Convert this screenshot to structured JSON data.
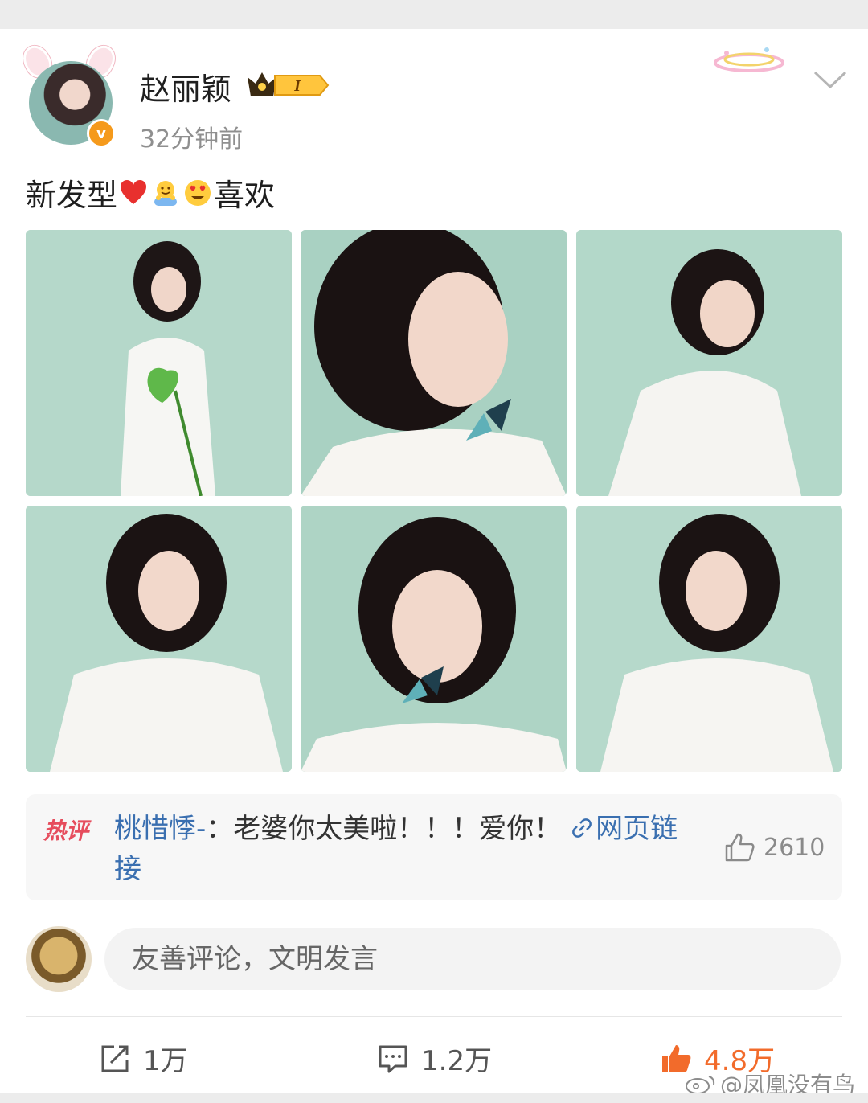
{
  "post": {
    "username": "赵丽颖",
    "vip_level": "I",
    "timestamp": "32分钟前",
    "text_before": "新发型",
    "text_after": "喜欢",
    "emojis": [
      "heart-emoji",
      "hug-emoji",
      "heart-eyes-emoji"
    ],
    "photo_count": 6
  },
  "hot_comment": {
    "badge": "热评",
    "author": "桃惜悸-",
    "separator": "：",
    "body": "老婆你太美啦！！！爱你！ ",
    "link_label": "网页链接",
    "likes": "2610"
  },
  "composer": {
    "placeholder": "友善评论，文明发言"
  },
  "actions": {
    "share_count": "1万",
    "comment_count": "1.2万",
    "like_count": "4.8万"
  },
  "watermark": "@凤凰没有鸟",
  "colors": {
    "accent": "#f26b2b",
    "link": "#3a6fb0",
    "hot_badge": "#e64d5d",
    "verified": "#f59a1c",
    "photo_background": "#b9d9cc"
  }
}
